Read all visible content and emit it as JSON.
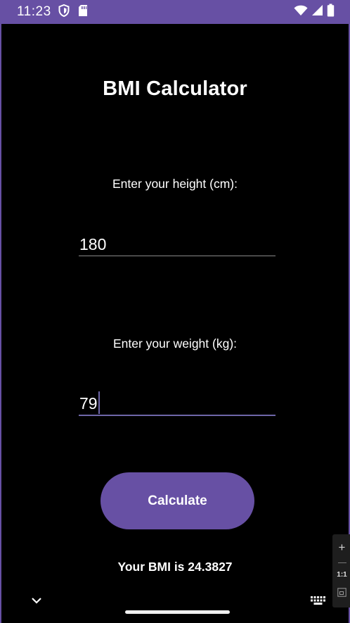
{
  "status_bar": {
    "time": "11:23",
    "left_icons": [
      "shield-icon",
      "sd-card-icon"
    ],
    "right_icons": [
      "wifi-icon",
      "signal-icon",
      "battery-icon"
    ],
    "color": "#6750a4"
  },
  "app": {
    "title": "BMI Calculator",
    "height_label": "Enter your height (cm):",
    "height_value": "180",
    "weight_label": "Enter your weight (kg):",
    "weight_value": "79",
    "calculate_label": "Calculate",
    "result_text": "Your BMI is 24.3827",
    "accent_color": "#6750a4"
  },
  "nav_bar": {
    "icons": [
      "chevron-down-icon",
      "home-handle",
      "keyboard-icon"
    ]
  },
  "zoom_panel": {
    "plus": "+",
    "ratio": "1:1"
  }
}
